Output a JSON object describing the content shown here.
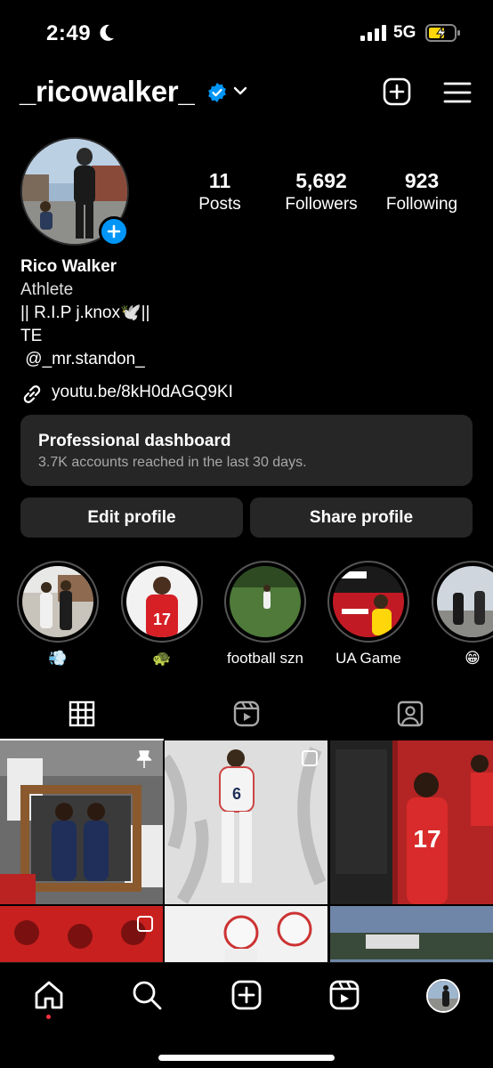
{
  "status_bar": {
    "time": "2:49",
    "network": "5G"
  },
  "header": {
    "username": "_ricowalker_"
  },
  "profile": {
    "stats": [
      {
        "value": "11",
        "label": "Posts"
      },
      {
        "value": "5,692",
        "label": "Followers"
      },
      {
        "value": "923",
        "label": "Following"
      }
    ],
    "name": "Rico Walker",
    "category": "Athlete",
    "bio_lines": [
      "|| R.I.P j.knox🕊️||",
      "TE",
      " @_mr.standon_"
    ],
    "link": "youtu.be/8kH0dAGQ9KI"
  },
  "dashboard": {
    "title": "Professional dashboard",
    "subtitle": "3.7K accounts reached in the last 30 days."
  },
  "buttons": {
    "edit": "Edit profile",
    "share": "Share profile"
  },
  "highlights": [
    {
      "label": "💨"
    },
    {
      "label": "🐢"
    },
    {
      "label": "football szn"
    },
    {
      "label": "UA Game"
    },
    {
      "label": "😁"
    }
  ],
  "colors": {
    "accent": "#0095f6",
    "panel": "#262626",
    "muted": "#a8a8a8",
    "notification": "#ff3040"
  }
}
